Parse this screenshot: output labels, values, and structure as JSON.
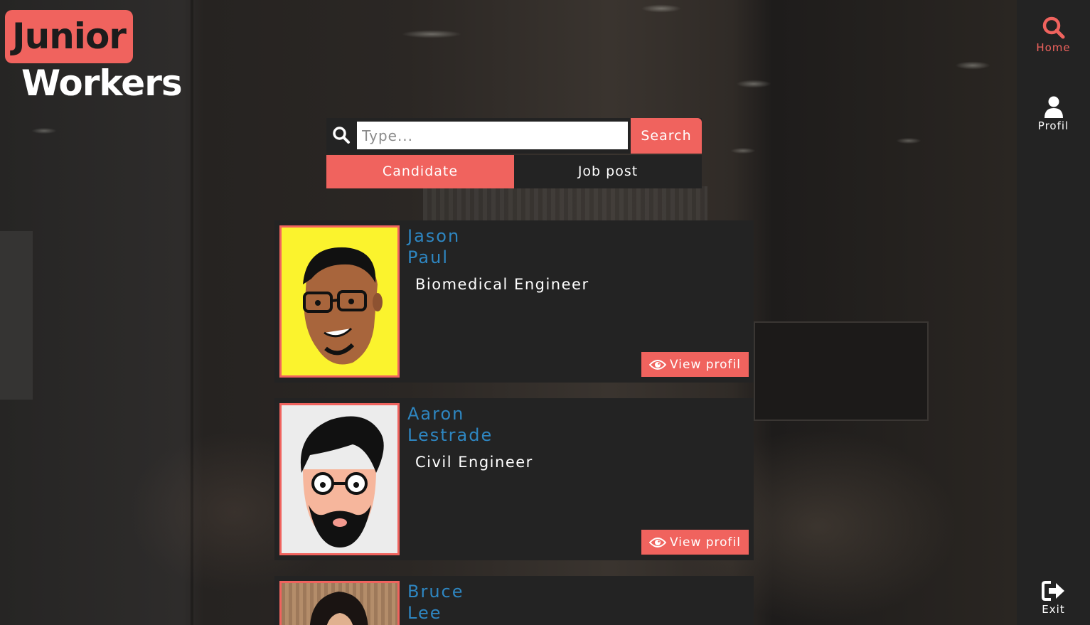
{
  "brand": {
    "line1": "Junior",
    "line2": "Workers"
  },
  "nav": {
    "items": [
      {
        "label": "Home",
        "icon": "search-icon",
        "active": true
      },
      {
        "label": "Profil",
        "icon": "user-icon",
        "active": false
      },
      {
        "label": "Exit",
        "icon": "sign-out-icon",
        "active": false
      }
    ]
  },
  "search": {
    "placeholder": "Type...",
    "value": "",
    "button_label": "Search"
  },
  "tabs": [
    {
      "label": "Candidate",
      "active": true
    },
    {
      "label": "Job post",
      "active": false
    }
  ],
  "candidates": [
    {
      "first_name": "Jason",
      "last_name": "Paul",
      "job": "Biomedical Engineer",
      "view_label": "View profil"
    },
    {
      "first_name": "Aaron",
      "last_name": "Lestrade",
      "job": "Civil Engineer",
      "view_label": "View profil"
    },
    {
      "first_name": "Bruce",
      "last_name": "Lee",
      "job": "",
      "view_label": ""
    }
  ],
  "colors": {
    "accent": "#f0635e",
    "name": "#2e86c1",
    "panel": "#232323"
  }
}
